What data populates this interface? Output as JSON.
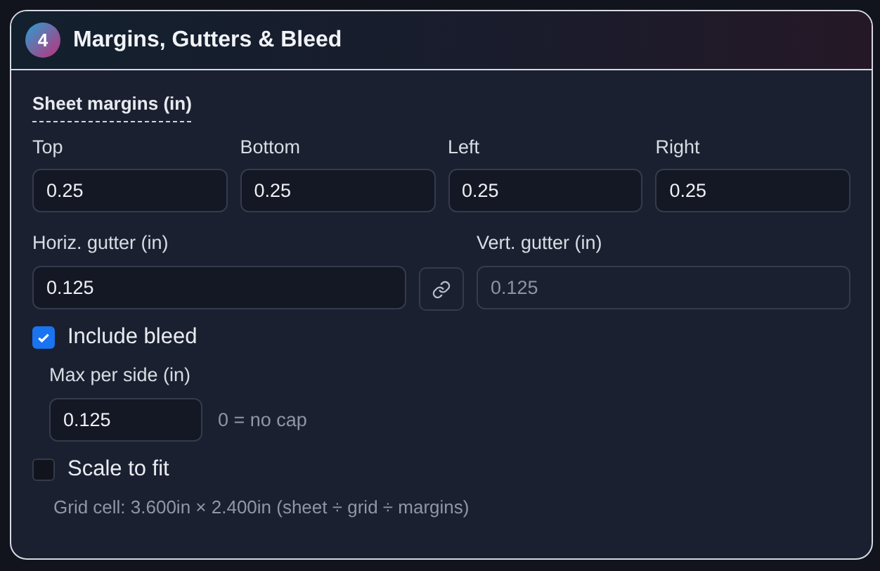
{
  "card": {
    "step": "4",
    "title": "Margins, Gutters & Bleed"
  },
  "sheet_margins": {
    "heading": "Sheet margins (in)",
    "fields": [
      {
        "label": "Top",
        "value": "0.25"
      },
      {
        "label": "Bottom",
        "value": "0.25"
      },
      {
        "label": "Left",
        "value": "0.25"
      },
      {
        "label": "Right",
        "value": "0.25"
      }
    ]
  },
  "gutters": {
    "horizontal": {
      "label": "Horiz. gutter (in)",
      "value": "0.125",
      "disabled": false
    },
    "linked": false,
    "vertical": {
      "label": "Vert. gutter (in)",
      "value": "0.125",
      "disabled": true
    }
  },
  "include_bleed": {
    "label": "Include bleed",
    "checked": true
  },
  "bleed": {
    "label": "Max per side (in)",
    "value": "0.125",
    "hint": "0 = no cap"
  },
  "scale_to_fit": {
    "label": "Scale to fit",
    "checked": false
  },
  "grid_cell": "Grid cell: 3.600in × 2.400in (sheet ÷ grid ÷ margins)"
}
